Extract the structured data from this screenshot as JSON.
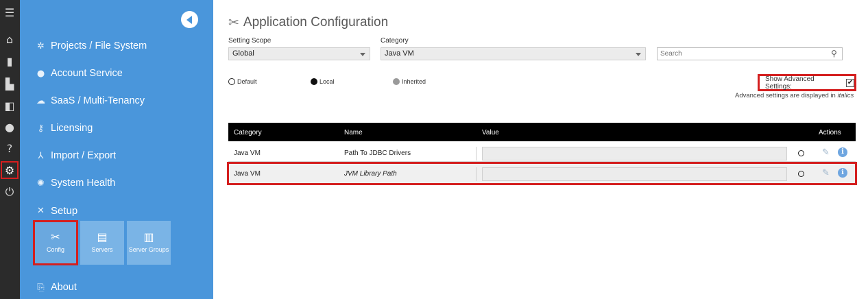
{
  "rail": {
    "icons": [
      "menu-icon",
      "home-icon",
      "briefcase-icon",
      "note-icon",
      "book-icon",
      "user-icon",
      "help-icon",
      "gear-icon",
      "power-icon"
    ]
  },
  "sidebar": {
    "items": [
      {
        "label": "Projects / File System",
        "icon": "project-icon"
      },
      {
        "label": "Account Service",
        "icon": "account-icon"
      },
      {
        "label": "SaaS / Multi-Tenancy",
        "icon": "cloud-icon"
      },
      {
        "label": "Licensing",
        "icon": "key-icon"
      },
      {
        "label": "Import / Export",
        "icon": "import-export-icon"
      },
      {
        "label": "System Health",
        "icon": "health-icon"
      },
      {
        "label": "Setup",
        "icon": "tools-icon"
      },
      {
        "label": "About",
        "icon": "about-icon"
      }
    ],
    "tiles": [
      {
        "label": "Config",
        "icon": "config-icon"
      },
      {
        "label": "Servers",
        "icon": "servers-icon"
      },
      {
        "label": "Server Groups",
        "icon": "server-groups-icon"
      }
    ]
  },
  "main": {
    "title": "Application Configuration",
    "scope_label": "Setting Scope",
    "scope_value": "Global",
    "category_label": "Category",
    "category_value": "Java VM",
    "search_placeholder": "Search",
    "legend": {
      "default": "Default",
      "local": "Local",
      "inherited": "Inherited"
    },
    "advanced_label": "Show Advanced Settings:",
    "advanced_checked": true,
    "advanced_note_prefix": "Advanced settings are displayed in ",
    "advanced_note_em": "italics"
  },
  "table": {
    "headers": {
      "category": "Category",
      "name": "Name",
      "value": "Value",
      "actions": "Actions"
    },
    "rows": [
      {
        "category": "Java VM",
        "name": "Path To JDBC Drivers",
        "value": "",
        "advanced": false
      },
      {
        "category": "Java VM",
        "name": "JVM Library Path",
        "value": "",
        "advanced": true
      }
    ]
  },
  "colors": {
    "rail": "#2b2b2b",
    "sidebar": "#4a96db",
    "highlight": "#d41f1f",
    "header": "#000000"
  }
}
